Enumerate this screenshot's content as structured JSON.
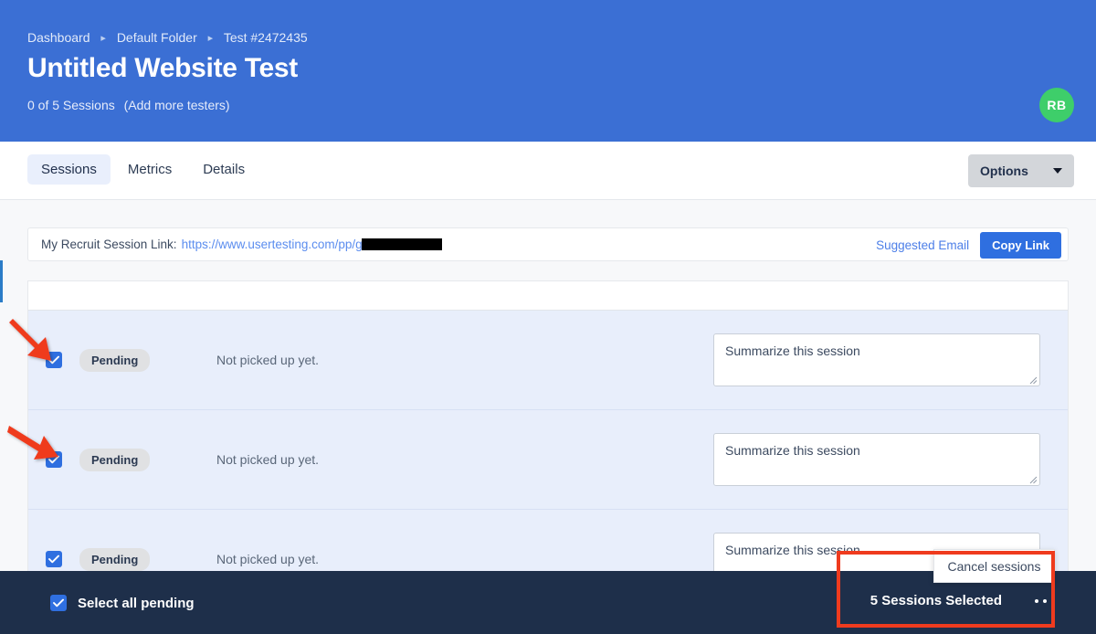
{
  "header": {
    "breadcrumb": [
      "Dashboard",
      "Default Folder",
      "Test #2472435"
    ],
    "title": "Untitled Website Test",
    "sessions_summary": "0 of 5 Sessions",
    "add_testers": "(Add more testers)",
    "avatar_initials": "RB",
    "bg_color": "#3b6fd4",
    "avatar_color": "#3ece6a"
  },
  "tabbar": {
    "tabs": [
      {
        "label": "Sessions",
        "active": true
      },
      {
        "label": "Metrics",
        "active": false
      },
      {
        "label": "Details",
        "active": false
      }
    ],
    "options_label": "Options",
    "caret_icon": "chevron-down-icon"
  },
  "recruit": {
    "label": "My Recruit Session Link:",
    "link_text": "https://www.usertesting.com/pp/g",
    "redacted": true,
    "suggested_email_label": "Suggested Email",
    "copy_link_label": "Copy Link",
    "copy_link_color": "#2f6fe0"
  },
  "sessions_table": {
    "header_cells": [
      "",
      "",
      "",
      ""
    ],
    "rows": [
      {
        "checked": true,
        "status": "Pending",
        "pickup": "Not picked up yet.",
        "summary_placeholder": "Summarize this session"
      },
      {
        "checked": true,
        "status": "Pending",
        "pickup": "Not picked up yet.",
        "summary_placeholder": "Summarize this session"
      },
      {
        "checked": true,
        "status": "Pending",
        "pickup": "Not picked up yet.",
        "summary_placeholder": "Summarize this session"
      }
    ],
    "selected_row_bg": "#e8eefb"
  },
  "selection_bar": {
    "select_all_label": "Select all pending",
    "select_all_checked": true,
    "selected_count_label": "5 Sessions Selected",
    "overflow_icon": "ellipsis-icon",
    "bg_color": "#1e2f4a"
  },
  "popup_menu": {
    "items": [
      {
        "label": "Cancel sessions"
      }
    ]
  },
  "annotations": {
    "highlight_color": "#ef3b1e",
    "arrows": 2,
    "box_target": "5 Sessions Selected"
  }
}
